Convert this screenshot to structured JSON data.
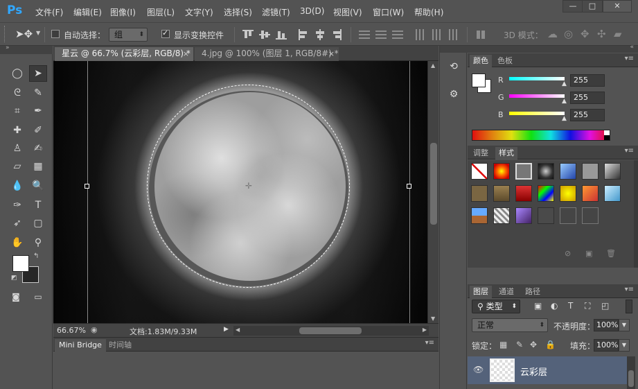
{
  "app": {
    "logo": "Ps"
  },
  "menu": [
    "文件(F)",
    "编辑(E)",
    "图像(I)",
    "图层(L)",
    "文字(Y)",
    "选择(S)",
    "滤镜(T)",
    "3D(D)",
    "视图(V)",
    "窗口(W)",
    "帮助(H)"
  ],
  "window_controls": {
    "minimize": "—",
    "maximize": "□",
    "close": "✕"
  },
  "options": {
    "auto_select_label": "自动选择：",
    "auto_select_value": "组",
    "show_transform_label": "显示变换控件",
    "mode_3d_label": "3D 模式："
  },
  "tabs": [
    {
      "label": "星云 @ 66.7% (云彩层, RGB/8) *",
      "close": "×"
    },
    {
      "label": "4.jpg @ 100% (图层 1, RGB/8#) *",
      "close": "×"
    }
  ],
  "status": {
    "zoom": "66.67%",
    "doc_info": "文档:1.83M/9.33M"
  },
  "bottom_panel": {
    "tabs": [
      "Mini Bridge",
      "时间轴"
    ]
  },
  "color_panel": {
    "tabs": [
      "颜色",
      "色板"
    ],
    "channels": [
      {
        "name": "R",
        "value": "255",
        "color": "#00e5e5"
      },
      {
        "name": "G",
        "value": "255",
        "color": "#e524e5"
      },
      {
        "name": "B",
        "value": "255",
        "color": "#e5e51a"
      }
    ]
  },
  "styles_panel": {
    "tabs": [
      "调整",
      "样式"
    ]
  },
  "layers_panel": {
    "tabs": [
      "图层",
      "通道",
      "路径"
    ],
    "filter_label": "类型",
    "blend_mode": "正常",
    "opacity_label": "不透明度：",
    "opacity_value": "100%",
    "lock_label": "锁定：",
    "fill_label": "填充：",
    "fill_value": "100%",
    "layers": [
      {
        "name": "云彩层",
        "visible": true
      }
    ]
  },
  "colors": {
    "accent_ps": "#31a8ff",
    "selected_layer": "#54627a"
  }
}
